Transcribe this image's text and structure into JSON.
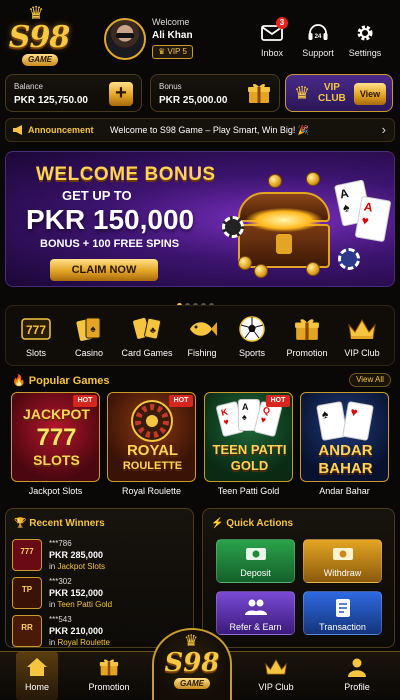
{
  "brand": {
    "logo_text": "S98",
    "logo_sub": "GAME"
  },
  "user": {
    "welcome": "Welcome",
    "name": "Ali Khan",
    "vip": "VIP 5"
  },
  "header_actions": [
    {
      "label": "Inbox",
      "icon": "mail-icon",
      "badge": "3"
    },
    {
      "label": "Support",
      "icon": "headset-icon"
    },
    {
      "label": "Settings",
      "icon": "gear-icon"
    }
  ],
  "balance": {
    "label": "Balance",
    "value": "PKR 125,750.00",
    "add": "+"
  },
  "bonus": {
    "label": "Bonus",
    "value": "PKR 25,000.00",
    "icon": "gift-icon"
  },
  "vip_club": {
    "label_line1": "VIP",
    "label_line2": "CLUB",
    "button": "View"
  },
  "announcement": {
    "label": "Announcement",
    "text": "Welcome to S98 Game – Play Smart, Win Big! 🎉"
  },
  "banner": {
    "title": "WELCOME BONUS",
    "subtitle": "GET UP TO",
    "amount": "PKR 150,000",
    "line": "BONUS + 100 FREE SPINS",
    "cta": "CLAIM NOW",
    "slides": 5,
    "active_slide": 1
  },
  "categories": [
    {
      "label": "Slots",
      "icon": "slot-777-icon"
    },
    {
      "label": "Casino",
      "icon": "cards-icon"
    },
    {
      "label": "Card Games",
      "icon": "playing-cards-icon"
    },
    {
      "label": "Fishing",
      "icon": "fish-icon"
    },
    {
      "label": "Sports",
      "icon": "soccer-ball-icon"
    },
    {
      "label": "Promotion",
      "icon": "gift-icon"
    },
    {
      "label": "VIP Club",
      "icon": "crown-icon"
    }
  ],
  "popular": {
    "title": "Popular Games",
    "view_all": "View All",
    "games": [
      {
        "tile_line1": "JACKPOT",
        "tile_line2": "777",
        "tile_line3": "SLOTS",
        "caption": "Jackpot Slots",
        "hot": "HOT"
      },
      {
        "tile_line1": "ROYAL",
        "tile_line2": "ROULETTE",
        "caption": "Royal Roulette",
        "hot": "HOT"
      },
      {
        "tile_line1": "TEEN PATTI",
        "tile_line2": "GOLD",
        "caption": "Teen Patti Gold",
        "hot": "HOT"
      },
      {
        "tile_line1": "ANDAR",
        "tile_line2": "BAHAR",
        "caption": "Andar Bahar"
      }
    ]
  },
  "winners": {
    "title": "Recent Winners",
    "items": [
      {
        "user": "***786",
        "amount": "PKR 285,000",
        "prefix": "in",
        "game": "Jackpot Slots",
        "thumb": "777"
      },
      {
        "user": "***302",
        "amount": "PKR 152,000",
        "prefix": "in",
        "game": "Teen Patti Gold",
        "thumb": "TP"
      },
      {
        "user": "***543",
        "amount": "PKR 210,000",
        "prefix": "in",
        "game": "Royal Roulette",
        "thumb": "RR"
      }
    ]
  },
  "quick_actions": {
    "title": "Quick Actions",
    "items": [
      {
        "label": "Deposit",
        "icon": "cash-icon",
        "color": "#1f8a3a"
      },
      {
        "label": "Withdraw",
        "icon": "wallet-icon",
        "color": "#c98a19"
      },
      {
        "label": "Refer & Earn",
        "icon": "users-icon",
        "color": "#6a3bc4"
      },
      {
        "label": "Transaction",
        "icon": "document-icon",
        "color": "#2457c4"
      }
    ]
  },
  "bottom_nav": [
    {
      "label": "Home",
      "icon": "home-icon",
      "active": true
    },
    {
      "label": "Promotion",
      "icon": "gift-icon"
    },
    {
      "label": "VIP Club",
      "icon": "crown-icon"
    },
    {
      "label": "Profile",
      "icon": "user-icon"
    }
  ],
  "colors": {
    "gold": "#f5c542",
    "background": "#0a0806",
    "hot": "#d7261e",
    "purple": "#3d1470"
  }
}
